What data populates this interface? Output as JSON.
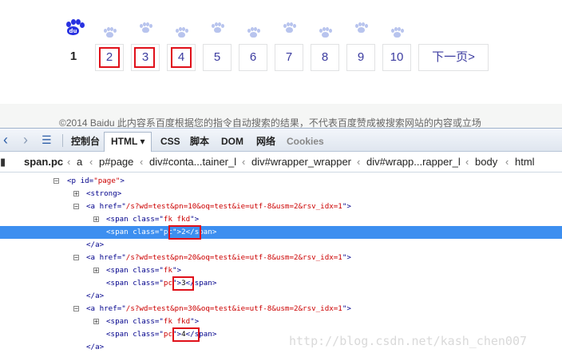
{
  "pager": {
    "current": "1",
    "pages": [
      "2",
      "3",
      "4",
      "5",
      "6",
      "7",
      "8",
      "9",
      "10"
    ],
    "next_label": "下一页>"
  },
  "footer": {
    "text": "©2014 Baidu 此内容系百度根据您的指令自动搜索的结果，不代表百度赞成被搜索网站的内容或立场"
  },
  "devtools": {
    "tabs": [
      "控制台",
      "HTML",
      "CSS",
      "脚本",
      "DOM",
      "网络",
      "Cookies"
    ],
    "active_tab": "HTML",
    "active_dropdown": "▾",
    "breadcrumb": [
      "span.pc",
      "a",
      "p#page",
      "div#conta...tainer_l",
      "div#wrapper_wrapper",
      "div#wrapp...rapper_l",
      "body",
      "html"
    ],
    "tree": {
      "p_open": "<p id=\"page\">",
      "strong": "<strong>",
      "a1_href": "/s?wd=test&pn=10&oq=test&ie=utf-8&usm=2&rsv_idx=1",
      "a2_href": "/s?wd=test&pn=20&oq=test&ie=utf-8&usm=2&rsv_idx=1",
      "a3_href": "/s?wd=test&pn=30&oq=test&ie=utf-8&usm=2&rsv_idx=1",
      "span_fk_fkd": "fk fkd",
      "span_fk": "fk",
      "span_pc": "pc",
      "pc_values": [
        "2",
        "3",
        "4"
      ],
      "a_close": "</a>"
    }
  },
  "watermark": "http://blog.csdn.net/kash_chen007",
  "colors": {
    "accent": "#3d8ff0",
    "highlight_box": "#e0101a",
    "link": "#3c3ca0"
  }
}
